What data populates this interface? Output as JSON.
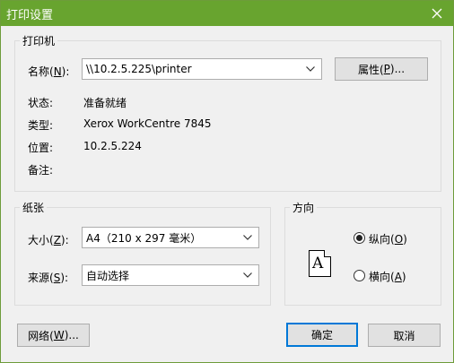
{
  "window": {
    "title": "打印设置"
  },
  "printer_group": {
    "label": "打印机",
    "name_label_prefix": "名称(",
    "name_label_key": "N",
    "name_label_suffix": "):",
    "name_value": "\\\\10.2.5.225\\printer",
    "properties_prefix": "属性(",
    "properties_key": "P",
    "properties_suffix": ")...",
    "status_label": "状态:",
    "status_value": "准备就绪",
    "type_label": "类型:",
    "type_value": "Xerox WorkCentre 7845",
    "where_label": "位置:",
    "where_value": "10.2.5.224",
    "comment_label": "备注:",
    "comment_value": ""
  },
  "paper_group": {
    "label": "纸张",
    "size_label_prefix": "大小(",
    "size_label_key": "Z",
    "size_label_suffix": "):",
    "size_value": "A4（210 x 297 毫米）",
    "source_label_prefix": "来源(",
    "source_label_key": "S",
    "source_label_suffix": "):",
    "source_value": "自动选择"
  },
  "orientation_group": {
    "label": "方向",
    "portrait_prefix": "纵向(",
    "portrait_key": "O",
    "portrait_suffix": ")",
    "portrait_checked": true,
    "landscape_prefix": "横向(",
    "landscape_key": "A",
    "landscape_suffix": ")",
    "landscape_checked": false,
    "page_letter": "A"
  },
  "buttons": {
    "network_prefix": "网络(",
    "network_key": "W",
    "network_suffix": ")...",
    "ok": "确定",
    "cancel": "取消"
  }
}
